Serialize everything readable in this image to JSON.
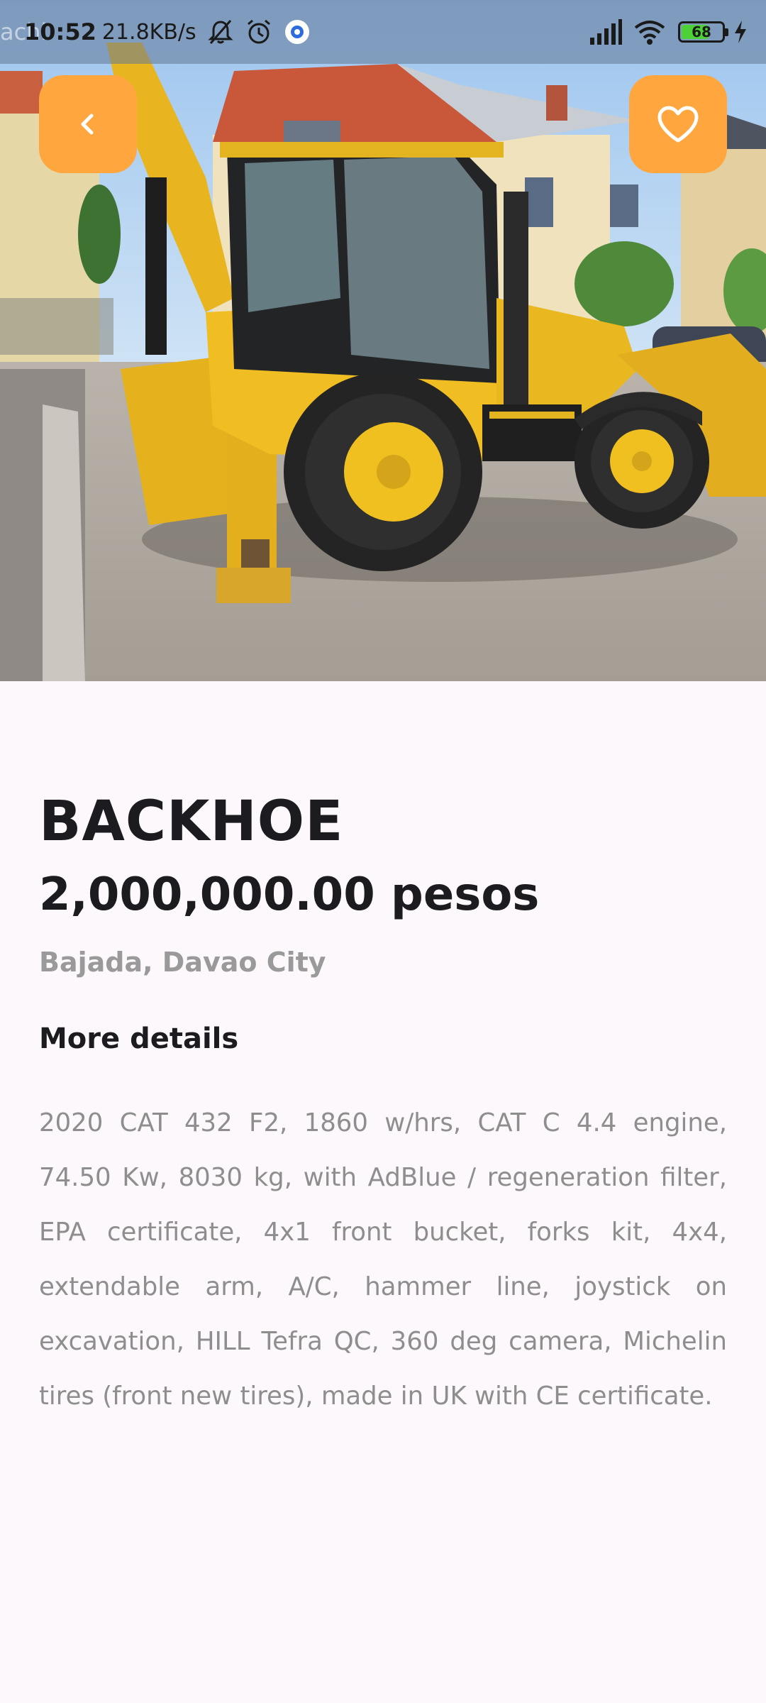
{
  "status_bar": {
    "ghost_text": "achi",
    "time": "10:52",
    "network_speed": "21.8KB/s",
    "battery_level": "68",
    "battery_fraction": 0.68,
    "icons": [
      "mute-notifications-icon",
      "alarm-icon",
      "app-notification-icon",
      "signal-icon",
      "wifi-icon",
      "battery-icon",
      "charging-icon"
    ]
  },
  "hero": {
    "image_subject": "yellow backhoe loader photo"
  },
  "buttons": {
    "back_icon": "chevron-left-icon",
    "favorite_icon": "heart-outline-icon"
  },
  "listing": {
    "title": "BACKHOE",
    "price": "2,000,000.00 pesos",
    "location": "Bajada, Davao City",
    "details_heading": "More details",
    "description": "2020 CAT 432 F2, 1860 w/hrs, CAT C 4.4 engine, 74.50 Kw, 8030 kg, with AdBlue / regeneration filter, EPA certificate, 4x1 front bucket, forks kit, 4x4, extendable arm, A/C, hammer line, joystick on excavation, HILL Tefra QC, 360 deg camera, Michelin tires (front new tires), made in UK with CE certificate."
  },
  "colors": {
    "accent": "#ffa63f",
    "background": "#fdf8fb",
    "text_primary": "#1c1b1f",
    "text_secondary": "#9a9a9a",
    "battery_green": "#4cd137"
  }
}
